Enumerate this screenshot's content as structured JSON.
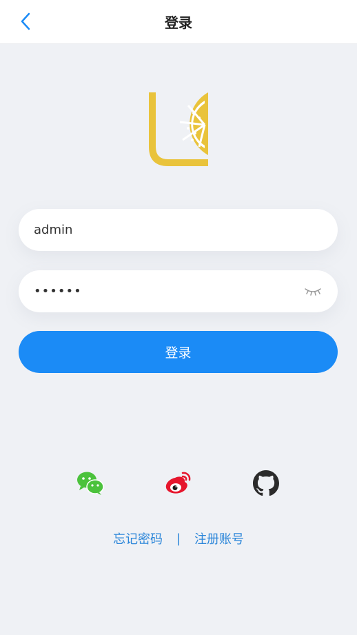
{
  "nav": {
    "title": "登录",
    "back_icon": "chevron-left-icon"
  },
  "logo": {
    "icon": "lemon-logo-icon"
  },
  "form": {
    "username_value": "admin",
    "password_value": "••••••",
    "password_toggle_icon": "eye-closed-icon",
    "submit_label": "登录"
  },
  "social": {
    "items": [
      {
        "name": "wechat",
        "icon": "wechat-icon",
        "color": "#4bc23c"
      },
      {
        "name": "weibo",
        "icon": "weibo-icon",
        "color": "#e6162d"
      },
      {
        "name": "github",
        "icon": "github-icon",
        "color": "#2b2b2b"
      }
    ]
  },
  "links": {
    "forgot_password": "忘记密码",
    "separator": "|",
    "register": "注册账号"
  },
  "colors": {
    "primary": "#1b8bf6",
    "link": "#2b86d9",
    "logo": "#e9c33b",
    "background": "#eff1f5"
  }
}
